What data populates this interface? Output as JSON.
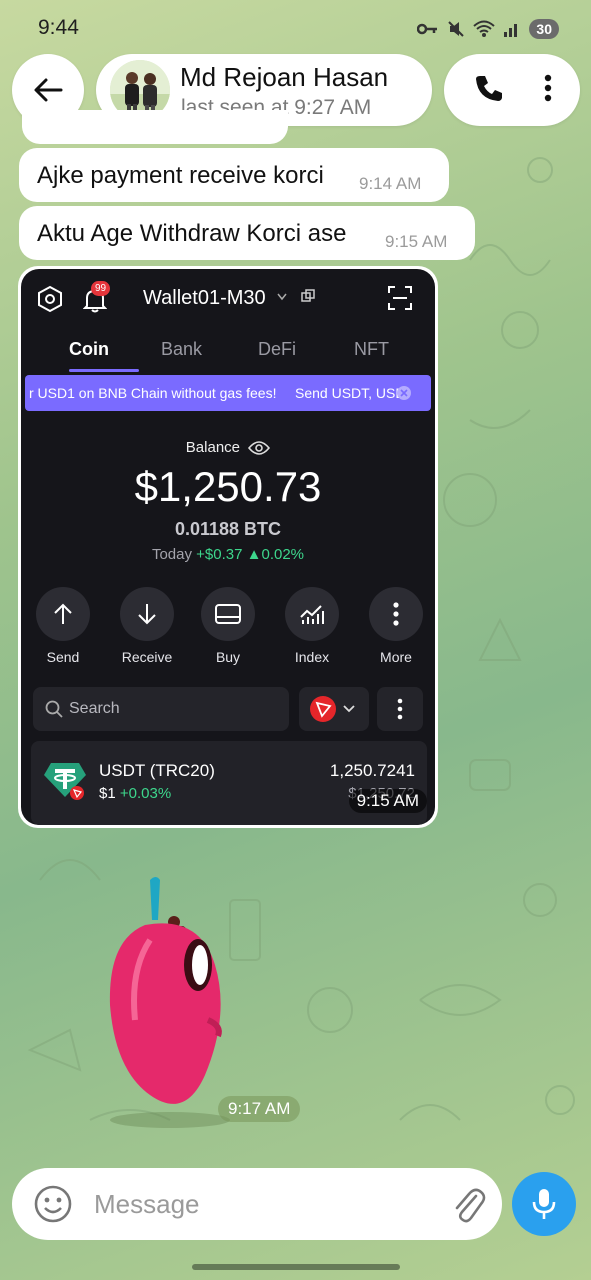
{
  "status_bar": {
    "time": "9:44",
    "battery": "30",
    "icons": [
      "key-icon",
      "mute-icon",
      "wifi-icon",
      "signal-icon"
    ]
  },
  "header": {
    "contact_name": "Md Rejoan Hasan",
    "last_seen": "last seen at 9:27 AM",
    "icons": [
      "back-arrow-icon",
      "phone-icon",
      "more-vertical-icon"
    ]
  },
  "messages": [
    {
      "text": "Ajke payment receive korci",
      "time": "9:14 AM"
    },
    {
      "text": "Aktu Age Withdraw Korci ase",
      "time": "9:15 AM"
    }
  ],
  "screenshot": {
    "notification_count": "99",
    "wallet_name": "Wallet01-M30",
    "tabs": [
      "Coin",
      "Bank",
      "DeFi",
      "NFT"
    ],
    "active_tab": "Coin",
    "banner_text": "r USD1 on BNB Chain without gas fees!",
    "banner_text2": "Send USDT, USD",
    "balance_label": "Balance",
    "balance": "$1,250.73",
    "balance_btc": "0.01188 BTC",
    "today_label": "Today",
    "today_change": "+$0.37",
    "today_pct": "0.02%",
    "actions": [
      "Send",
      "Receive",
      "Buy",
      "Index",
      "More"
    ],
    "search_placeholder": "Search",
    "token": {
      "name": "USDT (TRC20)",
      "price": "$1",
      "change": "+0.03%",
      "amount": "1,250.7241",
      "fiat": "$1,250.72"
    },
    "time": "9:15 AM"
  },
  "sticker": {
    "time": "9:17 AM"
  },
  "composer": {
    "placeholder": "Message"
  },
  "colors": {
    "accent": "#2aa0ee",
    "wallet_accent": "#7a6bff",
    "positive": "#3dd68c"
  }
}
